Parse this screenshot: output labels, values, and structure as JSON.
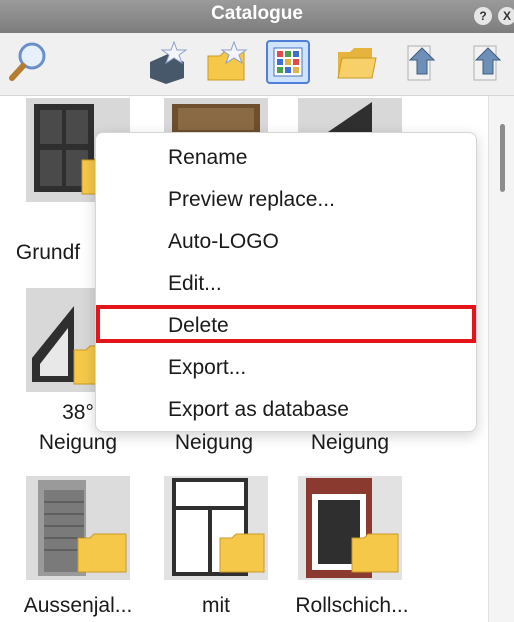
{
  "window": {
    "title": "Catalogue",
    "help_glyph": "?",
    "close_glyph": "X"
  },
  "toolbar": {
    "tools": [
      {
        "icon": "search-icon"
      },
      {
        "icon": "new-catalogue-star-icon"
      },
      {
        "icon": "new-folder-star-icon"
      },
      {
        "icon": "grid-view-icon",
        "active": true
      },
      {
        "icon": "open-folder-icon"
      },
      {
        "icon": "up-arrow-page-icon"
      },
      {
        "icon": "up-arrow-page-2-icon"
      }
    ]
  },
  "items": {
    "row1": [
      "Grundf",
      "",
      ""
    ],
    "row2": [
      "38°",
      "Neigung",
      "Neigung",
      "Neigung"
    ],
    "row3": [
      "Aussenjal...",
      "mit",
      "Rollschich..."
    ]
  },
  "context_menu": {
    "items": [
      "Rename",
      "Preview replace...",
      "Auto-LOGO",
      "Edit...",
      "Delete",
      "Export...",
      "Export as database"
    ],
    "highlighted": "Delete",
    "highlight_color": "#e4141b"
  }
}
